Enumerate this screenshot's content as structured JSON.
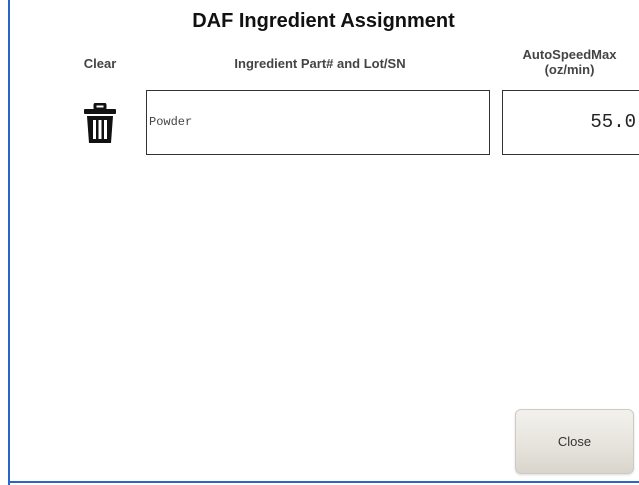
{
  "dialog": {
    "title": "DAF Ingredient Assignment",
    "accent_color": "#2a66c8"
  },
  "columns": {
    "clear": "Clear",
    "ingredient": "Ingredient Part# and Lot/SN",
    "speed": "AutoSpeedMax\n(oz/min)"
  },
  "row": {
    "clear_icon": "trash-icon",
    "ingredient_value": "Powder",
    "speed_value": "55.0"
  },
  "actions": {
    "close_label": "Close"
  }
}
